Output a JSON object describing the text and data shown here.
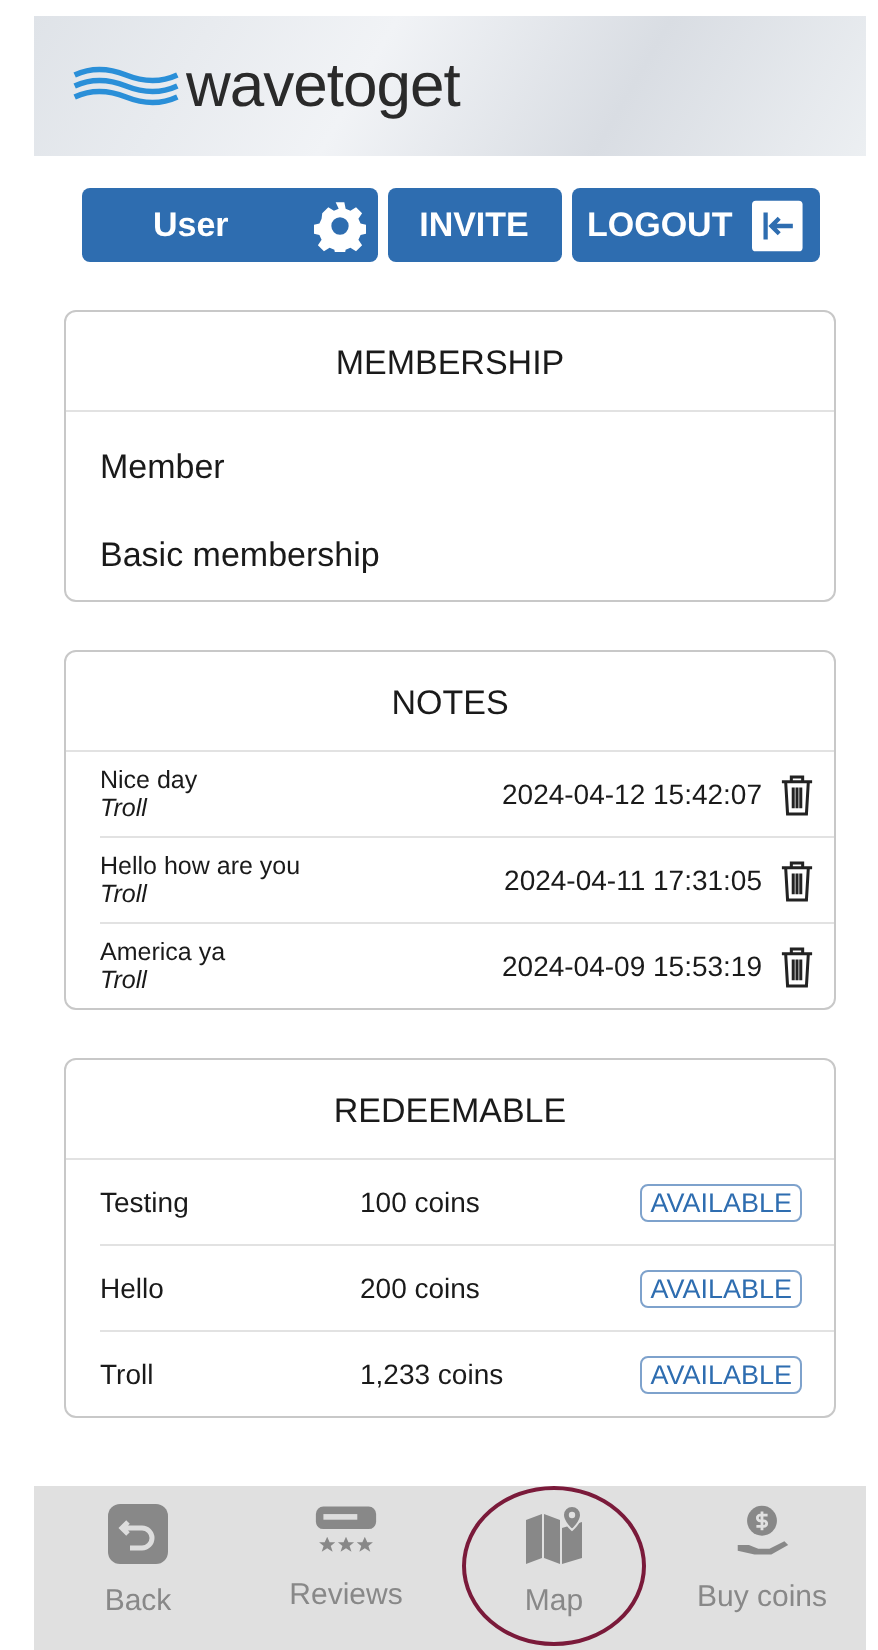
{
  "header": {
    "logo": "wavetoget"
  },
  "actions": [
    {
      "kind": "settings",
      "label": "User"
    },
    {
      "kind": "plain",
      "label": "INVITE"
    },
    {
      "kind": "logout",
      "label": "LOGOUT"
    }
  ],
  "membership": {
    "title": "MEMBERSHIP",
    "items": [
      "Member",
      "Basic membership"
    ]
  },
  "notes": {
    "title": "NOTES",
    "rows": [
      {
        "text": "Nice day",
        "author": "Troll",
        "time": "2024-04-12 15:42:07"
      },
      {
        "text": "Hello how are you",
        "author": "Troll",
        "time": "2024-04-11 17:31:05"
      },
      {
        "text": "America ya",
        "author": "Troll",
        "time": "2024-04-09 15:53:19"
      }
    ]
  },
  "redeemable": {
    "title": "REDEEMABLE",
    "rows": [
      {
        "name": "Testing",
        "price": "100 coins",
        "status": "AVAILABLE"
      },
      {
        "name": "Hello",
        "price": "200 coins",
        "status": "AVAILABLE"
      },
      {
        "name": "Troll",
        "price": "1,233 coins",
        "status": "AVAILABLE"
      }
    ]
  },
  "tab_bar": [
    {
      "kind": "back",
      "label": "Back",
      "selected": false
    },
    {
      "kind": "reviews",
      "label": "Reviews",
      "selected": false
    },
    {
      "kind": "map",
      "label": "Map",
      "selected": true
    },
    {
      "kind": "coins",
      "label": "Buy coins",
      "selected": false
    }
  ]
}
